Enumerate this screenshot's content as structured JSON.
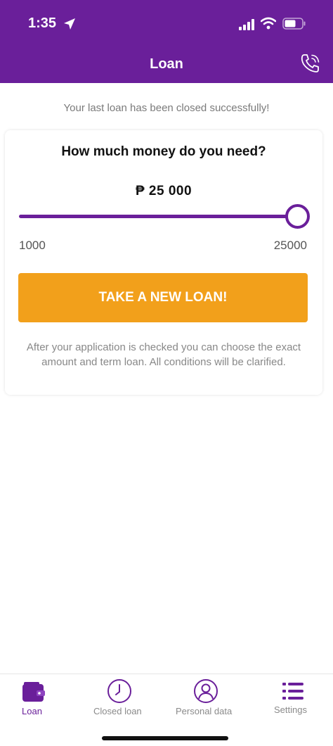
{
  "status_bar": {
    "time": "1:35"
  },
  "header": {
    "title": "Loan"
  },
  "banner": {
    "text": "Your last loan has been closed successfully!"
  },
  "loan_card": {
    "question": "How much money do you need?",
    "amount_display": "₱ 25 000",
    "slider": {
      "min_label": "1000",
      "max_label": "25000",
      "min": 1000,
      "max": 25000,
      "value": 25000
    },
    "cta_label": "TAKE A NEW LOAN!",
    "note": "After your application is checked you can choose the exact amount and term loan. All conditions will be clarified."
  },
  "bottom_nav": {
    "items": [
      {
        "label": "Loan",
        "icon": "wallet-icon",
        "active": true
      },
      {
        "label": "Closed loan",
        "icon": "clock-icon",
        "active": false
      },
      {
        "label": "Personal data",
        "icon": "user-icon",
        "active": false
      },
      {
        "label": "Settings",
        "icon": "list-icon",
        "active": false
      }
    ]
  },
  "colors": {
    "brand": "#6a1f9a",
    "accent": "#f2a01b",
    "muted": "#8a8a8a"
  }
}
